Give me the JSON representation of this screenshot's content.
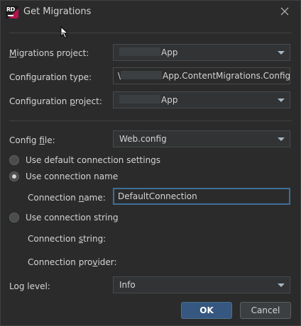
{
  "window": {
    "title": "Get Migrations",
    "logo_text": "RD"
  },
  "form": {
    "migrations_project": {
      "label": "Migrations project:",
      "value": "App"
    },
    "configuration_type": {
      "label": "Configuration type:",
      "value_prefix": "\\",
      "value": "App.ContentMigrations.Configura"
    },
    "configuration_project": {
      "label": "Configuration project:",
      "value": "App"
    },
    "config_file": {
      "label": "Config file:",
      "value": "Web.config"
    },
    "radio_default": {
      "label": "Use default connection settings",
      "checked": false
    },
    "radio_name": {
      "label": "Use connection name",
      "checked": true
    },
    "connection_name": {
      "label": "Connection name:",
      "value": "DefaultConnection"
    },
    "radio_string": {
      "label": "Use connection string",
      "checked": false
    },
    "connection_string": {
      "label": "Connection string:"
    },
    "connection_provider": {
      "label": "Connection provider:"
    },
    "log_level": {
      "label": "Log level:",
      "value": "Info"
    }
  },
  "buttons": {
    "ok": "OK",
    "cancel": "Cancel"
  },
  "colors": {
    "background": "#2b2b2b",
    "accent": "#365880",
    "focus_border": "#3d6f99"
  }
}
